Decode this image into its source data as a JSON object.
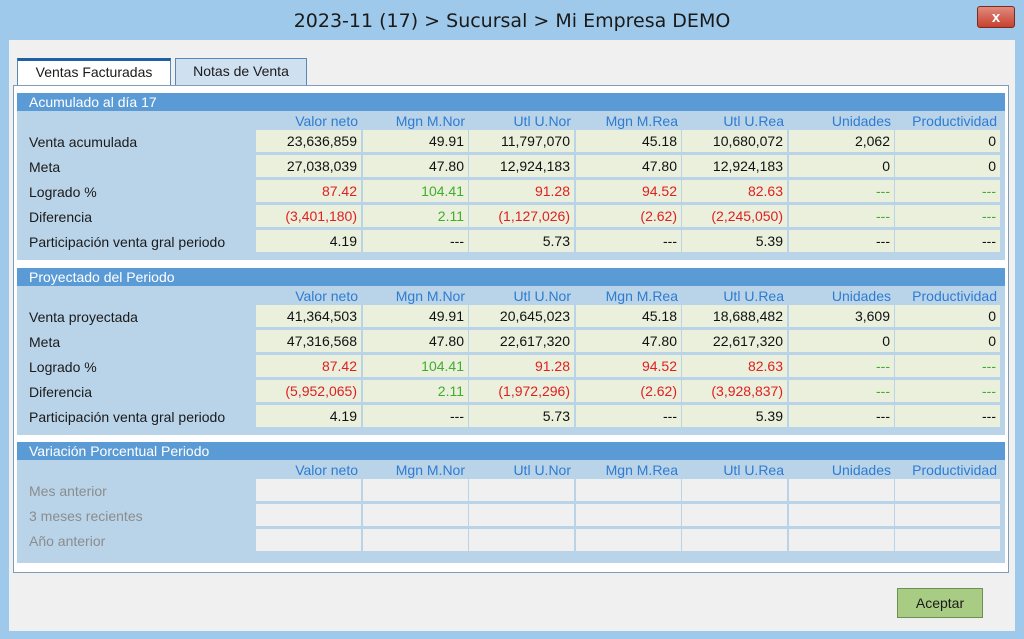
{
  "window": {
    "title": "2023-11 (17) > Sucursal > Mi Empresa DEMO",
    "close": "x"
  },
  "tabs": [
    "Ventas Facturadas",
    "Notas de Venta"
  ],
  "columns": [
    "Valor neto",
    "Mgn M.Nor",
    "Utl U.Nor",
    "Mgn M.Rea",
    "Utl U.Rea",
    "Unidades",
    "Productividad"
  ],
  "sections": [
    {
      "title": "Acumulado al día 17",
      "rows": [
        {
          "label": "Venta acumulada",
          "cells": [
            "23,636,859",
            "49.91",
            "11,797,070",
            "45.18",
            "10,680,072",
            "2,062",
            "0"
          ]
        },
        {
          "label": "Meta",
          "cells": [
            "27,038,039",
            "47.80",
            "12,924,183",
            "47.80",
            "12,924,183",
            "0",
            "0"
          ]
        },
        {
          "label": "Logrado %",
          "cells": [
            "87.42",
            "104.41",
            "91.28",
            "94.52",
            "82.63",
            "---",
            "---"
          ]
        },
        {
          "label": "Diferencia",
          "cells": [
            "(3,401,180)",
            "2.11",
            "(1,127,026)",
            "(2.62)",
            "(2,245,050)",
            "---",
            "---"
          ]
        },
        {
          "label": "Participación venta gral periodo",
          "cells": [
            "4.19",
            "---",
            "5.73",
            "---",
            "5.39",
            "---",
            "---"
          ]
        }
      ]
    },
    {
      "title": "Proyectado del Periodo",
      "rows": [
        {
          "label": "Venta proyectada",
          "cells": [
            "41,364,503",
            "49.91",
            "20,645,023",
            "45.18",
            "18,688,482",
            "3,609",
            "0"
          ]
        },
        {
          "label": "Meta",
          "cells": [
            "47,316,568",
            "47.80",
            "22,617,320",
            "47.80",
            "22,617,320",
            "0",
            "0"
          ]
        },
        {
          "label": "Logrado %",
          "cells": [
            "87.42",
            "104.41",
            "91.28",
            "94.52",
            "82.63",
            "---",
            "---"
          ]
        },
        {
          "label": "Diferencia",
          "cells": [
            "(5,952,065)",
            "2.11",
            "(1,972,296)",
            "(2.62)",
            "(3,928,837)",
            "---",
            "---"
          ]
        },
        {
          "label": "Participación venta gral periodo",
          "cells": [
            "4.19",
            "---",
            "5.73",
            "---",
            "5.39",
            "---",
            "---"
          ]
        }
      ]
    },
    {
      "title": "Variación Porcentual Periodo",
      "rows": [
        {
          "label": "Mes anterior",
          "cells": [
            "",
            "",
            "",
            "",
            "",
            "",
            ""
          ]
        },
        {
          "label": "3 meses recientes",
          "cells": [
            "",
            "",
            "",
            "",
            "",
            "",
            ""
          ]
        },
        {
          "label": "Año anterior",
          "cells": [
            "",
            "",
            "",
            "",
            "",
            "",
            ""
          ]
        }
      ]
    }
  ],
  "cell_colors": {
    "logrado": [
      "red",
      "green",
      "red",
      "red",
      "red",
      "green",
      "green"
    ],
    "diferencia": [
      "red",
      "green",
      "red",
      "red",
      "red",
      "green",
      "green"
    ]
  },
  "colors": {
    "accent": "#5b9bd5",
    "negative": "#e02020",
    "positive": "#3fae2a",
    "header": "#2e7bd1"
  },
  "actions": {
    "accept": "Aceptar"
  }
}
